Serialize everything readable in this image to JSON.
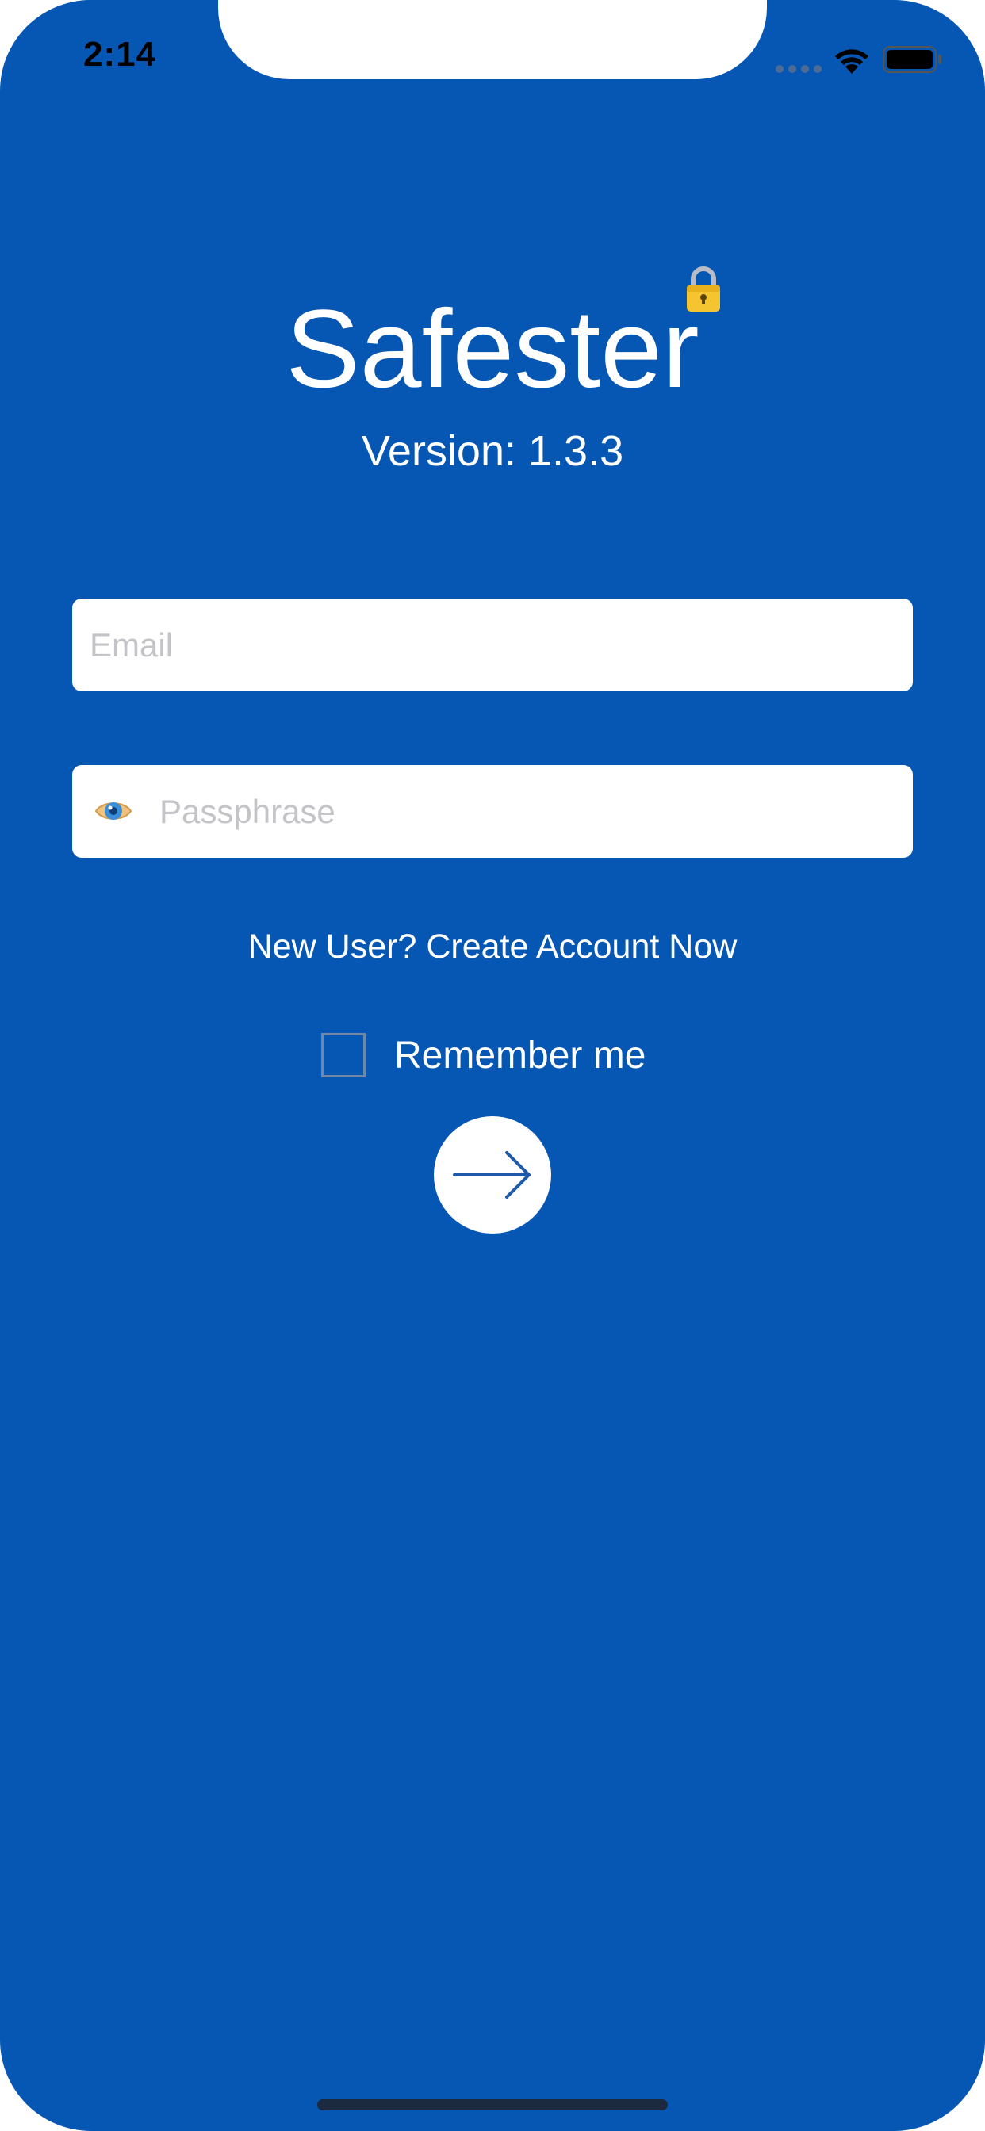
{
  "status_bar": {
    "time": "2:14",
    "icons": [
      "signal-dots-icon",
      "wifi-icon",
      "battery-icon"
    ]
  },
  "header": {
    "app_title": "Safester",
    "version": "Version: 1.3.3",
    "title_icon": "lock-icon"
  },
  "form": {
    "email_placeholder": "Email",
    "email_value": "",
    "passphrase_placeholder": "Passphrase",
    "passphrase_value": "",
    "passphrase_icon": "eye-icon",
    "create_account_label": "New User? Create Account Now",
    "remember_label": "Remember me",
    "remember_checked": false,
    "submit_icon": "arrow-right-icon"
  },
  "colors": {
    "background": "#0557b3",
    "accent": "#1e5aa8",
    "lock": "#f5c531"
  }
}
